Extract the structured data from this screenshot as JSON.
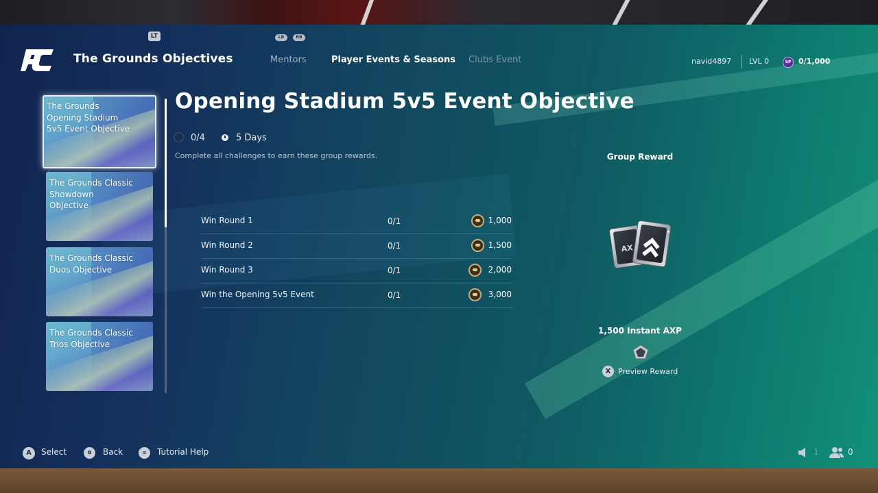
{
  "header": {
    "title": "The Grounds Objectives",
    "lt_badge": "LT",
    "lb_badge": "LB",
    "rb_badge": "RB",
    "tabs": [
      {
        "label": "Mentors"
      },
      {
        "label": "Player Events & Seasons"
      },
      {
        "label": "Clubs Event"
      }
    ],
    "username": "navid4897",
    "level": "LVL 0",
    "sp_icon": "SP",
    "sp_value": "0/1,000"
  },
  "sidebar": {
    "items": [
      {
        "label": "The Grounds Opening Stadium 5v5 Event Objective"
      },
      {
        "label": "The Grounds Classic Showdown Objective"
      },
      {
        "label": "The Grounds Classic Duos Objective"
      },
      {
        "label": "The Grounds Classic Trios Objective"
      }
    ]
  },
  "objective": {
    "title": "Opening Stadium 5v5 Event Objective",
    "progress": "0/4",
    "time_left": "5 Days",
    "description": "Complete all challenges to earn these group rewards.",
    "challenges": [
      {
        "name": "Win Round 1",
        "progress": "0/1",
        "reward": "1,000"
      },
      {
        "name": "Win Round 2",
        "progress": "0/1",
        "reward": "1,500"
      },
      {
        "name": "Win Round 3",
        "progress": "0/1",
        "reward": "2,000"
      },
      {
        "name": "Win the Opening 5v5 Event",
        "progress": "0/1",
        "reward": "3,000"
      }
    ]
  },
  "group_reward": {
    "title": "Group Reward",
    "name": "1,500 Instant AXP",
    "art_text": "AX",
    "preview_button": "X",
    "preview_label": "Preview Reward"
  },
  "footer": {
    "select_btn": "A",
    "select_label": "Select",
    "back_label": "Back",
    "help_label": "Tutorial Help",
    "notifications_count": "1",
    "friends_count": "0"
  },
  "colors": {
    "accent_green": "#3ec37a",
    "panel_left": "#10244e",
    "panel_right": "#12907a"
  }
}
